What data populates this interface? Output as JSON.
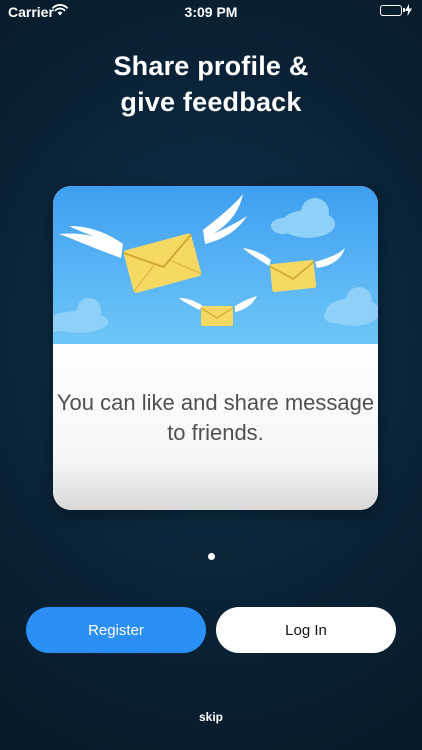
{
  "status_bar": {
    "carrier": "Carrier",
    "time": "3:09 PM",
    "wifi_icon": "wifi-icon",
    "battery_icon": "battery-charging-icon",
    "battery_level": 1.0,
    "battery_color": "#4cd964"
  },
  "onboarding": {
    "title_line1": "Share profile &",
    "title_line2": "give feedback",
    "card": {
      "illustration": "flying-envelopes-illustration",
      "message": "You can like and share message to friends."
    },
    "page_indicator": {
      "total": 3,
      "current": 2
    }
  },
  "actions": {
    "register_label": "Register",
    "login_label": "Log In",
    "skip_label": "skip"
  },
  "colors": {
    "background": "#0a2236",
    "accent": "#2a8ff6",
    "sky": "#4eb0f2",
    "envelope": "#f5d963"
  }
}
